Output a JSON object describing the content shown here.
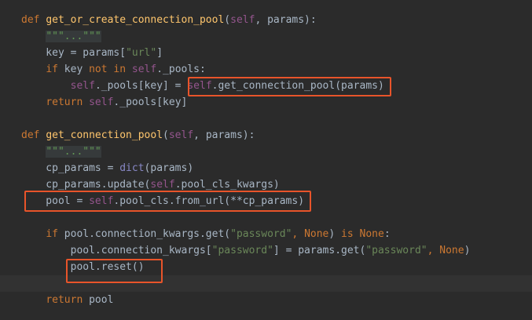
{
  "editor": {
    "language": "python",
    "lines": [
      {
        "tokens": [
          {
            "t": "def ",
            "c": "kw"
          },
          {
            "t": "get_or_create_connection_pool",
            "c": "fn"
          },
          {
            "t": "(",
            "c": "txt"
          },
          {
            "t": "self",
            "c": "self"
          },
          {
            "t": ", params):",
            "c": "txt"
          }
        ]
      },
      {
        "tokens": [
          {
            "t": "    ",
            "c": "txt"
          },
          {
            "t": "\"\"\"...\"\"\"",
            "c": "doc"
          }
        ]
      },
      {
        "tokens": [
          {
            "t": "    key = params[",
            "c": "txt"
          },
          {
            "t": "\"url\"",
            "c": "str"
          },
          {
            "t": "]",
            "c": "txt"
          }
        ]
      },
      {
        "tokens": [
          {
            "t": "    ",
            "c": "txt"
          },
          {
            "t": "if ",
            "c": "kw"
          },
          {
            "t": "key ",
            "c": "txt"
          },
          {
            "t": "not in ",
            "c": "kw"
          },
          {
            "t": "self",
            "c": "self"
          },
          {
            "t": "._pools:",
            "c": "txt"
          }
        ]
      },
      {
        "tokens": [
          {
            "t": "        ",
            "c": "txt"
          },
          {
            "t": "self",
            "c": "self"
          },
          {
            "t": "._pools[key] = ",
            "c": "txt"
          },
          {
            "t": "self",
            "c": "self"
          },
          {
            "t": ".get_connection_pool(params)",
            "c": "txt"
          }
        ]
      },
      {
        "tokens": [
          {
            "t": "    ",
            "c": "txt"
          },
          {
            "t": "return ",
            "c": "kw"
          },
          {
            "t": "self",
            "c": "self"
          },
          {
            "t": "._pools[key]",
            "c": "txt"
          }
        ]
      },
      {
        "tokens": []
      },
      {
        "tokens": [
          {
            "t": "def ",
            "c": "kw"
          },
          {
            "t": "get_connection_pool",
            "c": "fn"
          },
          {
            "t": "(",
            "c": "txt"
          },
          {
            "t": "self",
            "c": "self"
          },
          {
            "t": ", params):",
            "c": "txt"
          }
        ]
      },
      {
        "tokens": [
          {
            "t": "    ",
            "c": "txt"
          },
          {
            "t": "\"\"\"...\"\"\"",
            "c": "doc"
          }
        ]
      },
      {
        "tokens": [
          {
            "t": "    cp_params = ",
            "c": "txt"
          },
          {
            "t": "dict",
            "c": "bi"
          },
          {
            "t": "(params)",
            "c": "txt"
          }
        ]
      },
      {
        "tokens": [
          {
            "t": "    cp_params.update(",
            "c": "txt"
          },
          {
            "t": "self",
            "c": "self"
          },
          {
            "t": ".pool_cls_kwargs)",
            "c": "txt"
          }
        ]
      },
      {
        "tokens": [
          {
            "t": "    pool = ",
            "c": "txt"
          },
          {
            "t": "self",
            "c": "self"
          },
          {
            "t": ".pool_cls.from_url(**cp_params)",
            "c": "txt"
          }
        ]
      },
      {
        "tokens": []
      },
      {
        "tokens": [
          {
            "t": "    ",
            "c": "txt"
          },
          {
            "t": "if ",
            "c": "kw"
          },
          {
            "t": "pool.connection_kwargs.get(",
            "c": "txt"
          },
          {
            "t": "\"password\"",
            "c": "str"
          },
          {
            "t": ", ",
            "c": "kw"
          },
          {
            "t": "None",
            "c": "kw"
          },
          {
            "t": ") ",
            "c": "txt"
          },
          {
            "t": "is ",
            "c": "kw"
          },
          {
            "t": "None",
            "c": "kw"
          },
          {
            "t": ":",
            "c": "txt"
          }
        ]
      },
      {
        "tokens": [
          {
            "t": "        pool.connection_kwargs[",
            "c": "txt"
          },
          {
            "t": "\"password\"",
            "c": "str"
          },
          {
            "t": "] = params.get(",
            "c": "txt"
          },
          {
            "t": "\"password\"",
            "c": "str"
          },
          {
            "t": ", ",
            "c": "kw"
          },
          {
            "t": "None",
            "c": "kw"
          },
          {
            "t": ")",
            "c": "txt"
          }
        ]
      },
      {
        "tokens": [
          {
            "t": "        pool.reset()",
            "c": "txt"
          }
        ]
      },
      {
        "tokens": []
      },
      {
        "tokens": [
          {
            "t": "    ",
            "c": "txt"
          },
          {
            "t": "return ",
            "c": "kw"
          },
          {
            "t": "pool",
            "c": "txt"
          }
        ]
      }
    ],
    "current_line": 16,
    "highlight_color": "#e8542a"
  }
}
